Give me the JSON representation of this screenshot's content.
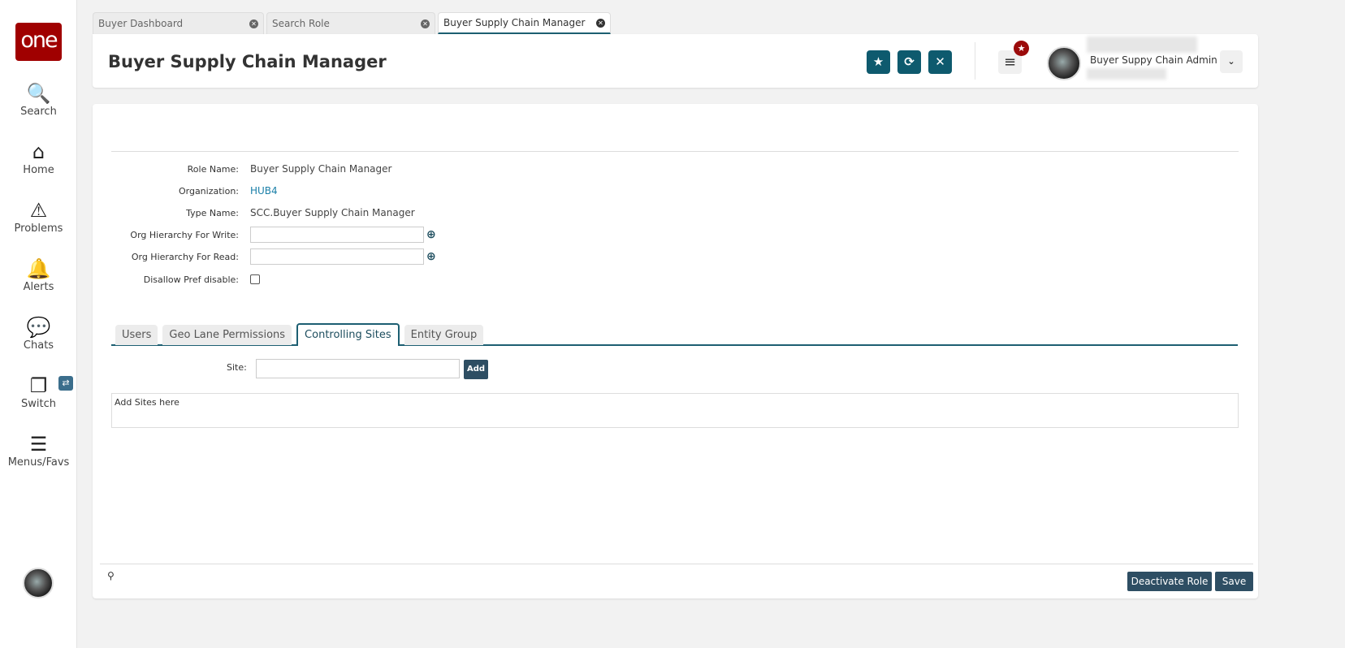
{
  "sidebar": {
    "logo": "one",
    "items": [
      {
        "label": "Search",
        "icon": "🔍"
      },
      {
        "label": "Home",
        "icon": "⌂"
      },
      {
        "label": "Problems",
        "icon": "⚠"
      },
      {
        "label": "Alerts",
        "icon": "🔔"
      },
      {
        "label": "Chats",
        "icon": "💬"
      },
      {
        "label": "Switch",
        "icon": "❐"
      },
      {
        "label": "Menus/Favs",
        "icon": "☰"
      }
    ],
    "switch_badge": "⇄"
  },
  "tabs": [
    {
      "label": "Buyer Dashboard"
    },
    {
      "label": "Search Role"
    },
    {
      "label": "Buyer Supply Chain Manager"
    }
  ],
  "header": {
    "title": "Buyer Supply Chain Manager",
    "user_name": "Buyer Suppy Chain Admin",
    "favorite_icon": "★",
    "refresh_icon": "⟳",
    "close_icon": "✕",
    "menu_icon": "≡",
    "notif_icon": "★",
    "dropdown_icon": "⌄"
  },
  "form": {
    "role_name_label": "Role Name:",
    "role_name": "Buyer Supply Chain Manager",
    "organization_label": "Organization:",
    "organization": "HUB4",
    "type_name_label": "Type Name:",
    "type_name": "SCC.Buyer Supply Chain Manager",
    "write_label": "Org Hierarchy For Write:",
    "write_value": "",
    "read_label": "Org Hierarchy For Read:",
    "read_value": "",
    "disallow_label": "Disallow Pref disable:"
  },
  "subtabs": [
    {
      "label": "Users"
    },
    {
      "label": "Geo Lane Permissions"
    },
    {
      "label": "Controlling Sites"
    },
    {
      "label": "Entity Group"
    }
  ],
  "sites": {
    "label": "Site:",
    "value": "",
    "add_label": "Add",
    "placeholder_text": "Add Sites here"
  },
  "footer": {
    "deactivate_label": "Deactivate Role",
    "save_label": "Save"
  }
}
